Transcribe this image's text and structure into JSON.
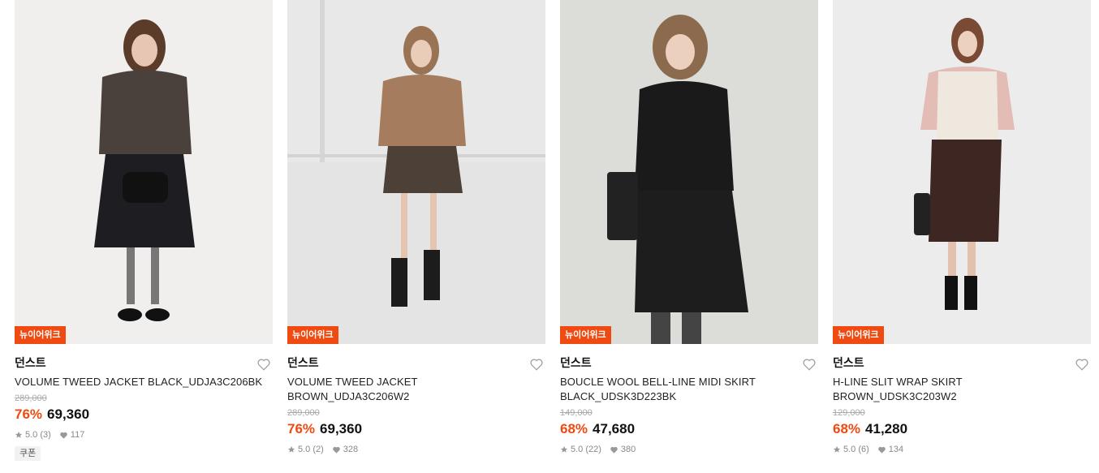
{
  "products": [
    {
      "badge": "뉴이어위크",
      "brand": "던스트",
      "name": "VOLUME TWEED JACKET BLACK_UDJA3C206BK",
      "original_price": "289,000",
      "discount": "76%",
      "price": "69,360",
      "rating": "5.0 (3)",
      "likes": "117",
      "coupon": "쿠폰",
      "colors": {
        "bg": "#f0efed",
        "top": "#4a403c",
        "bottom": "#1e1e22"
      }
    },
    {
      "badge": "뉴이어위크",
      "brand": "던스트",
      "name": "VOLUME TWEED JACKET BROWN_UDJA3C206W2",
      "original_price": "289,000",
      "discount": "76%",
      "price": "69,360",
      "rating": "5.0 (2)",
      "likes": "328",
      "coupon": "",
      "colors": {
        "bg": "#e4e4e4",
        "top": "#a67c5e",
        "bottom": "#4c4037"
      }
    },
    {
      "badge": "뉴이어위크",
      "brand": "던스트",
      "name": "BOUCLE WOOL BELL-LINE MIDI SKIRT BLACK_UDSK3D223BK",
      "original_price": "149,000",
      "discount": "68%",
      "price": "47,680",
      "rating": "5.0 (22)",
      "likes": "380",
      "coupon": "",
      "colors": {
        "bg": "#dcdcd8",
        "top": "#1a1a1a",
        "bottom": "#1d1d1d"
      }
    },
    {
      "badge": "뉴이어위크",
      "brand": "던스트",
      "name": "H-LINE SLIT WRAP SKIRT BROWN_UDSK3C203W2",
      "original_price": "129,000",
      "discount": "68%",
      "price": "41,280",
      "rating": "5.0 (6)",
      "likes": "134",
      "coupon": "",
      "colors": {
        "bg": "#ececec",
        "top": "#eee8df",
        "bottom": "#3e2622"
      }
    }
  ],
  "icons": {
    "wishlist": "heart-outline-icon",
    "rating": "star-icon",
    "likes": "heart-icon"
  }
}
